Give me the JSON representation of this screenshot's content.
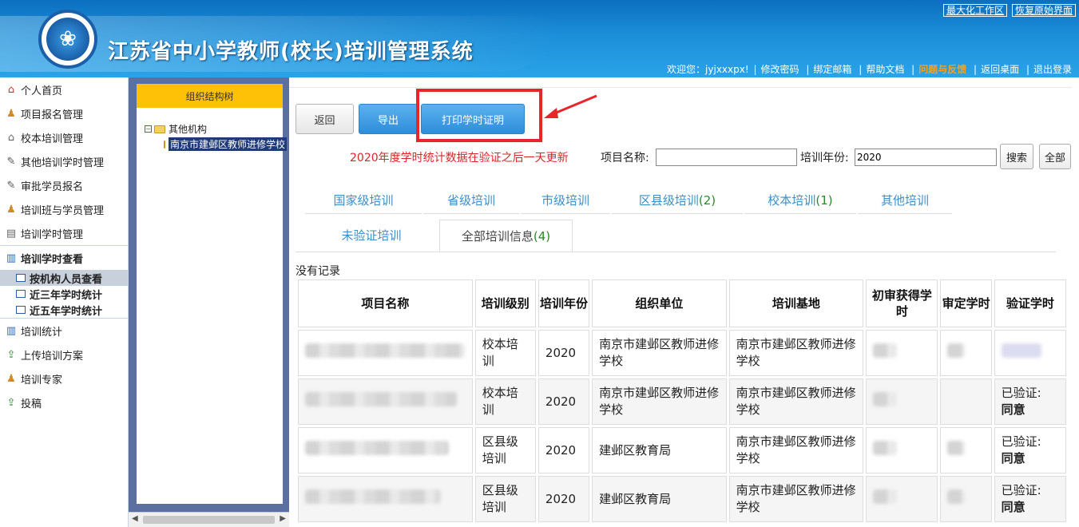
{
  "header": {
    "system_title": "江苏省中小学教师(校长)培训管理系统",
    "top_links": [
      "最大化工作区",
      "恢复原始界面"
    ],
    "welcome": "欢迎您：jyjxxxpx!",
    "user_links": [
      "修改密码",
      "绑定邮箱",
      "帮助文档",
      "问题与反馈",
      "返回桌面",
      "退出登录"
    ]
  },
  "sidebar": {
    "items_top": [
      {
        "label": "个人首页",
        "icon": "home-icon"
      },
      {
        "label": "项目报名管理",
        "icon": "users-icon"
      },
      {
        "label": "校本培训管理",
        "icon": "school-icon"
      },
      {
        "label": "其他培训学时管理",
        "icon": "edit-icon"
      },
      {
        "label": "审批学员报名",
        "icon": "edit-icon"
      },
      {
        "label": "培训班与学员管理",
        "icon": "users-icon"
      },
      {
        "label": "培训学时管理",
        "icon": "table-icon"
      }
    ],
    "group": {
      "label": "培训学时查看",
      "icon": "chart-icon",
      "children": [
        "按机构人员查看",
        "近三年学时统计",
        "近五年学时统计"
      ]
    },
    "items_bottom": [
      {
        "label": "培训统计",
        "icon": "chart-icon"
      },
      {
        "label": "上传培训方案",
        "icon": "upload-icon"
      },
      {
        "label": "培训专家",
        "icon": "users-icon"
      },
      {
        "label": "投稿",
        "icon": "upload-icon"
      }
    ]
  },
  "tree": {
    "title": "组织结构树",
    "root": "其他机构",
    "child": "南京市建邺区教师进修学校"
  },
  "toolbar": {
    "back": "返回",
    "export": "导出",
    "print": "打印学时证明"
  },
  "search": {
    "notice": "2020年度学时统计数据在验证之后一天更新",
    "project_label": "项目名称:",
    "project_value": "",
    "year_label": "培训年份:",
    "year_value": "2020",
    "search_btn": "搜索",
    "all_btn": "全部"
  },
  "tabs": [
    {
      "label": "国家级培训",
      "count": ""
    },
    {
      "label": "省级培训",
      "count": ""
    },
    {
      "label": "市级培训",
      "count": ""
    },
    {
      "label": "区县级培训",
      "count": "(2)"
    },
    {
      "label": "校本培训",
      "count": "(1)"
    },
    {
      "label": "其他培训",
      "count": ""
    },
    {
      "label": "未验证培训",
      "count": ""
    },
    {
      "label": "全部培训信息",
      "count": "(4)"
    }
  ],
  "no_record": "没有记录",
  "table": {
    "headers": [
      "项目名称",
      "培训级别",
      "培训年份",
      "组织单位",
      "培训基地",
      "初审获得学时",
      "审定学时",
      "验证学时"
    ],
    "rows": [
      {
        "level": "校本培训",
        "year": "2020",
        "org": "南京市建邺区教师进修学校",
        "base": "南京市建邺区教师进修学校",
        "verify_label": "",
        "verify_value": ""
      },
      {
        "level": "校本培训",
        "year": "2020",
        "org": "南京市建邺区教师进修学校",
        "base": "南京市建邺区教师进修学校",
        "verify_label": "已验证:",
        "verify_value": "同意"
      },
      {
        "level": "区县级培训",
        "year": "2020",
        "org": "建邺区教育局",
        "base": "南京市建邺区教师进修学校",
        "verify_label": "已验证:",
        "verify_value": "同意"
      },
      {
        "level": "区县级培训",
        "year": "2020",
        "org": "建邺区教育局",
        "base": "南京市建邺区教师进修学校",
        "verify_label": "已验证:",
        "verify_value": "同意"
      }
    ]
  }
}
